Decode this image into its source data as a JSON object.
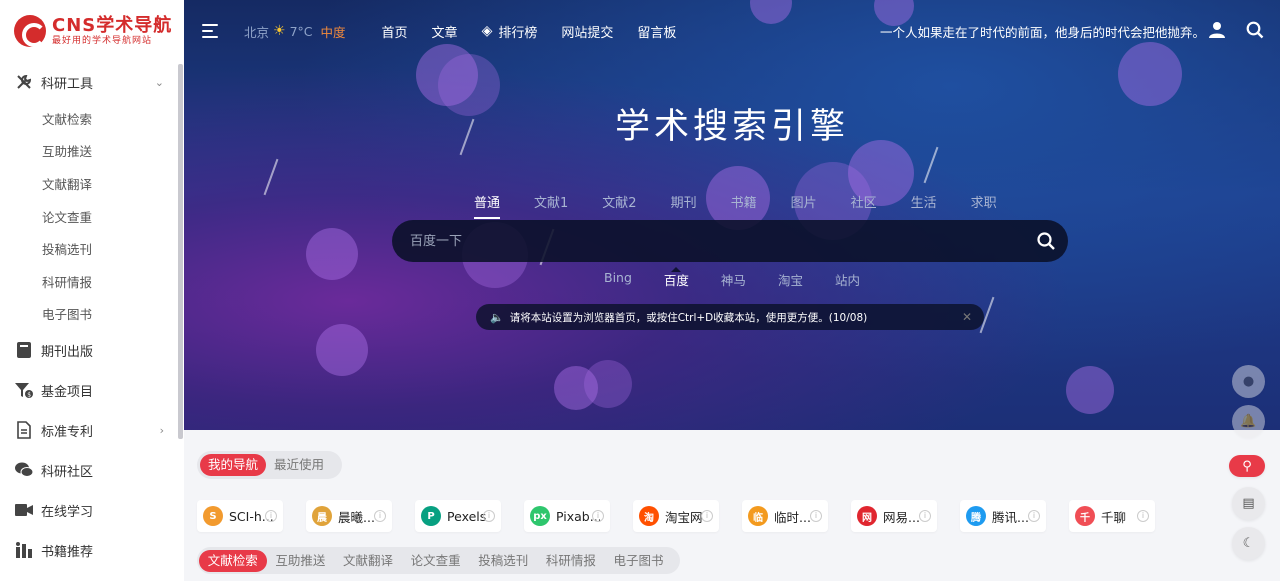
{
  "logo": {
    "title": "CNS学术导航",
    "subtitle": "最好用的学术导航网站"
  },
  "sidebar": {
    "groups": [
      {
        "label": "科研工具",
        "icon": "tools-icon"
      },
      {
        "label": "期刊出版",
        "icon": "book-icon"
      },
      {
        "label": "基金项目",
        "icon": "funnel-icon"
      },
      {
        "label": "标准专利",
        "icon": "document-icon"
      },
      {
        "label": "科研社区",
        "icon": "chat-icon"
      },
      {
        "label": "在线学习",
        "icon": "video-icon"
      },
      {
        "label": "书籍推荐",
        "icon": "bookshelf-icon"
      }
    ],
    "tool_items": [
      "文献检索",
      "互助推送",
      "文献翻译",
      "论文查重",
      "投稿选刊",
      "科研情报",
      "电子图书"
    ]
  },
  "topbar": {
    "weather": {
      "city": "北京",
      "temp": "7°C",
      "aqi": "中度"
    },
    "nav": [
      "首页",
      "文章",
      "排行榜",
      "网站提交",
      "留言板"
    ],
    "motto": "一个人如果走在了时代的前面，他身后的时代会把他抛弃。"
  },
  "hero": {
    "title": "学术搜索引擎",
    "tabs": [
      "普通",
      "文献1",
      "文献2",
      "期刊",
      "书籍",
      "图片",
      "社区",
      "生活",
      "求职"
    ],
    "active_tab": "普通",
    "search_placeholder": "百度一下",
    "engines": [
      "Bing",
      "百度",
      "神马",
      "淘宝",
      "站内"
    ],
    "active_engine": "百度",
    "notice": "请将本站设置为浏览器首页，或按住Ctrl+D收藏本站，使用更方便。(10/08)"
  },
  "quick": {
    "tabs": [
      "我的导航",
      "最近使用"
    ],
    "cards": [
      {
        "label": "SCI-h...",
        "color": "#f29a2e",
        "glyph": "S"
      },
      {
        "label": "晨曦...",
        "color": "#e0a33a",
        "glyph": "晨"
      },
      {
        "label": "Pexels",
        "color": "#07a081",
        "glyph": "P"
      },
      {
        "label": "Pixab...",
        "color": "#2ec66d",
        "glyph": "px"
      },
      {
        "label": "淘宝网",
        "color": "#ff5000",
        "glyph": "淘"
      },
      {
        "label": "临时...",
        "color": "#f39a1e",
        "glyph": "临"
      },
      {
        "label": "网易...",
        "color": "#e0262f",
        "glyph": "网"
      },
      {
        "label": "腾讯...",
        "color": "#1e9bf0",
        "glyph": "腾"
      },
      {
        "label": "千聊",
        "color": "#f04e55",
        "glyph": "千"
      }
    ],
    "sub_tabs": [
      "文献检索",
      "互助推送",
      "文献翻译",
      "论文查重",
      "投稿选刊",
      "科研情报",
      "电子图书"
    ]
  },
  "colors": {
    "accent": "#e83a48",
    "brand": "#d42c2c",
    "hero_dark": "#152a63"
  }
}
